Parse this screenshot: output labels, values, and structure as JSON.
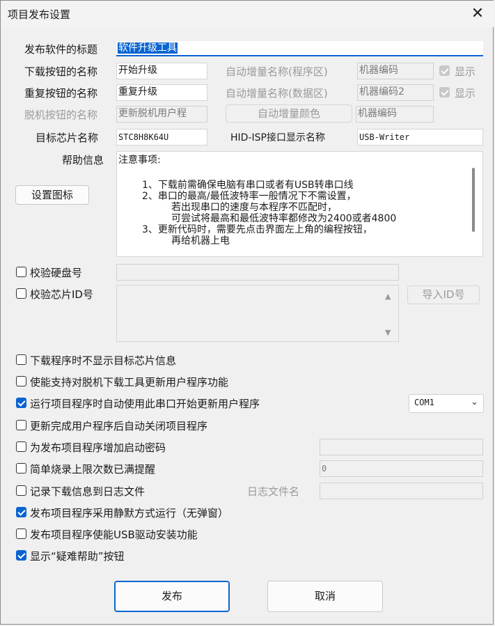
{
  "window": {
    "title": "项目发布设置",
    "close_glyph": "✕"
  },
  "form": {
    "release_title_label": "发布软件的标题",
    "release_title_value": "软件升级工具",
    "download_btn_label": "下载按钮的名称",
    "download_btn_value": "开始升级",
    "repeat_btn_label": "重复按钮的名称",
    "repeat_btn_value": "重复升级",
    "offline_btn_label": "脱机按钮的名称",
    "offline_btn_value": "更新脱机用户程",
    "auto_inc_program_label": "自动增量名称(程序区)",
    "auto_inc_program_value": "机器编码",
    "auto_inc_data_label": "自动增量名称(数据区)",
    "auto_inc_data_value": "机器编码2",
    "show_label_1": "显示",
    "show_label_2": "显示",
    "auto_inc_color_button": "自动增量颜色",
    "auto_inc_color_value": "机器编码",
    "target_chip_label": "目标芯片名称",
    "target_chip_value": "STC8H8K64U",
    "hid_isp_label": "HID-ISP接口显示名称",
    "hid_isp_value": "USB-Writer",
    "help_label": "帮助信息",
    "set_icon_button": "设置图标",
    "help_lines": [
      "注意事项:",
      "1、下载前需确保电脑有串口或者有USB转串口线",
      "2、串口的最高/最低波特率一般情况下不需设置，",
      "若出现串口的速度与本程序不匹配时，",
      "可尝试将最高和最低波特率都修改为2400或者4800",
      "3、更新代码时，需要先点击界面左上角的编程按钮，",
      "再给机器上电"
    ]
  },
  "options": {
    "verify_disk": {
      "label": "校验硬盘号",
      "checked": false
    },
    "verify_chip_id": {
      "label": "校验芯片ID号",
      "checked": false
    },
    "import_id_button": "导入ID号",
    "no_target_info": {
      "label": "下载程序时不显示目标芯片信息",
      "checked": false
    },
    "enable_offline_update": {
      "label": "使能支持对脱机下载工具更新用户程序功能",
      "checked": false
    },
    "auto_serial_update": {
      "label": "运行项目程序时自动使用此串口开始更新用户程序",
      "checked": true
    },
    "com_port": "COM1",
    "auto_close": {
      "label": "更新完成用户程序后自动关闭项目程序",
      "checked": false
    },
    "startup_password": {
      "label": "为发布项目程序增加启动密码",
      "checked": false
    },
    "burn_limit": {
      "label": "简单烧录上限次数已满提醒",
      "checked": false
    },
    "burn_limit_value": "0",
    "log_to_file": {
      "label": "记录下载信息到日志文件",
      "checked": false
    },
    "log_file_name_label": "日志文件名",
    "silent_mode": {
      "label": "发布项目程序采用静默方式运行（无弹窗）",
      "checked": true
    },
    "usb_driver_install": {
      "label": "发布项目程序使能USB驱动安装功能",
      "checked": false
    },
    "show_help_button": {
      "label": "显示“疑难帮助”按钮",
      "checked": true
    }
  },
  "footer": {
    "publish": "发布",
    "cancel": "取消"
  },
  "colors": {
    "accent": "#0a64d2",
    "background": "#f0f0f0"
  }
}
